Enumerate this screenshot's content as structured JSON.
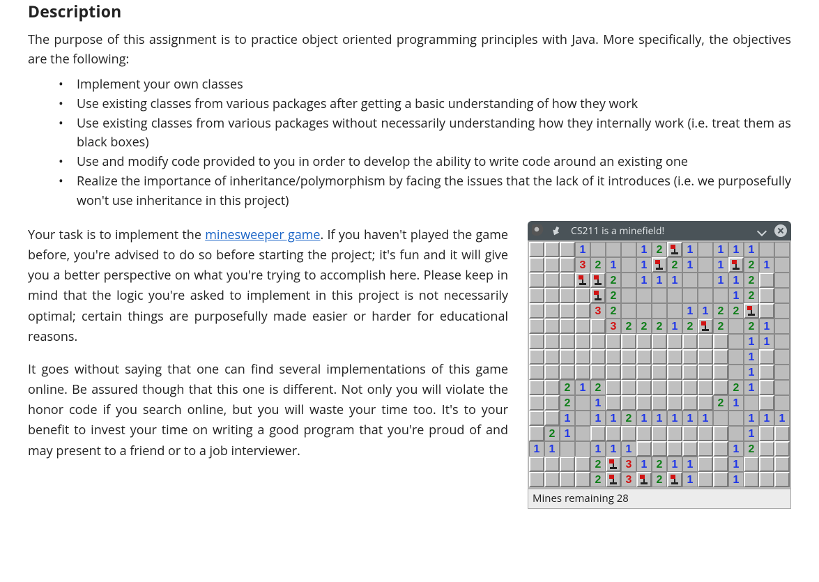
{
  "heading": "Description",
  "intro": "The purpose of this assignment is to practice object oriented programming principles with Java. More specifically, the objectives are the following:",
  "objectives": [
    "Implement your own classes",
    "Use existing classes from various packages after getting a basic understanding of how they work",
    "Use existing classes from various packages without necessarily understanding how they internally work (i.e. treat them as black boxes)",
    "Use and modify code provided to you in order to develop the ability to write code around an existing one",
    "Realize the importance of inheritance/polymorphism by facing the issues that the lack of it introduces (i.e. we purposefully won't use inheritance in this project)"
  ],
  "para1_pre": "Your task is to implement the ",
  "para1_link": "minesweeper game",
  "para1_post": ". If you haven't played the game before, you're advised to do so before starting the project; it's fun and it will give you a better perspective on what you're trying to accomplish here. Please keep in mind that the logic you're asked to implement in this project is not necessarily optimal; certain things are purposefully made easier or harder for educational reasons.",
  "para2": "It goes without saying that one can find several implementations of this game online. Be assured though that this one is different. Not only you will violate the honor code if you search online, but you will waste your time too. It's to your benefit to invest your time on writing a good program that you're proud of and may present to a friend or to a job interviewer.",
  "window_title": "CS211 is a minefield!",
  "mines_remaining_label": "Mines remaining 28",
  "board": [
    [
      ".",
      ".",
      ".",
      "1",
      "",
      "",
      "",
      "1",
      "2",
      "F",
      "1",
      "",
      "1",
      "1",
      "1",
      "",
      ""
    ],
    [
      ".",
      ".",
      ".",
      "3",
      "2",
      "1",
      "",
      "1",
      "F",
      "2",
      "1",
      "",
      "1",
      "F",
      "2",
      "1",
      ""
    ],
    [
      ".",
      ".",
      ".",
      "F",
      "F",
      "2",
      "",
      "1",
      "1",
      "1",
      "",
      "",
      "1",
      "1",
      "2",
      ".",
      ""
    ],
    [
      ".",
      ".",
      ".",
      ".",
      "F",
      "2",
      "",
      "",
      "",
      "",
      "",
      "",
      "",
      "1",
      "2",
      ".",
      ""
    ],
    [
      ".",
      ".",
      ".",
      ".",
      "3",
      "2",
      "",
      "",
      "",
      "",
      "1",
      "1",
      "2",
      "2",
      "F",
      ".",
      ""
    ],
    [
      ".",
      ".",
      ".",
      ".",
      ".",
      "3",
      "2",
      "2",
      "2",
      "1",
      "2",
      "F",
      "2",
      "",
      "2",
      "1",
      ""
    ],
    [
      ".",
      ".",
      ".",
      ".",
      ".",
      ".",
      ".",
      ".",
      ".",
      ".",
      ".",
      ".",
      ".",
      "",
      "1",
      "1",
      ""
    ],
    [
      ".",
      ".",
      ".",
      ".",
      ".",
      ".",
      ".",
      ".",
      ".",
      ".",
      ".",
      ".",
      ".",
      "",
      "1",
      ".",
      ""
    ],
    [
      ".",
      ".",
      ".",
      ".",
      ".",
      ".",
      ".",
      ".",
      ".",
      ".",
      ".",
      ".",
      ".",
      "",
      "1",
      ".",
      ""
    ],
    [
      ".",
      ".",
      "2",
      "1",
      "2",
      ".",
      ".",
      ".",
      ".",
      ".",
      ".",
      ".",
      ".",
      "2",
      "1",
      ".",
      ""
    ],
    [
      ".",
      ".",
      "2",
      "",
      "1",
      ".",
      ".",
      ".",
      ".",
      ".",
      ".",
      ".",
      "2",
      "1",
      "",
      ".",
      ""
    ],
    [
      ".",
      ".",
      "1",
      "",
      "1",
      "1",
      "2",
      "1",
      "1",
      "1",
      "1",
      "1",
      "",
      "",
      "1",
      "1",
      "1"
    ],
    [
      ".",
      "2",
      "1",
      "",
      ".",
      ".",
      ".",
      ".",
      ".",
      ".",
      ".",
      ".",
      ".",
      "",
      "1",
      ".",
      "."
    ],
    [
      "1",
      "1",
      "",
      "",
      "1",
      "1",
      "1",
      ".",
      ".",
      ".",
      ".",
      ".",
      ".",
      "1",
      "2",
      ".",
      "."
    ],
    [
      ".",
      ".",
      ".",
      ".",
      "2",
      "F",
      "3",
      "1",
      "2",
      "1",
      "1",
      ".",
      ".",
      "1",
      ".",
      ".",
      "."
    ],
    [
      ".",
      ".",
      ".",
      ".",
      "2",
      "F",
      "3",
      "F",
      "2",
      "F",
      "1",
      ".",
      ".",
      "1",
      ".",
      ".",
      "."
    ]
  ]
}
